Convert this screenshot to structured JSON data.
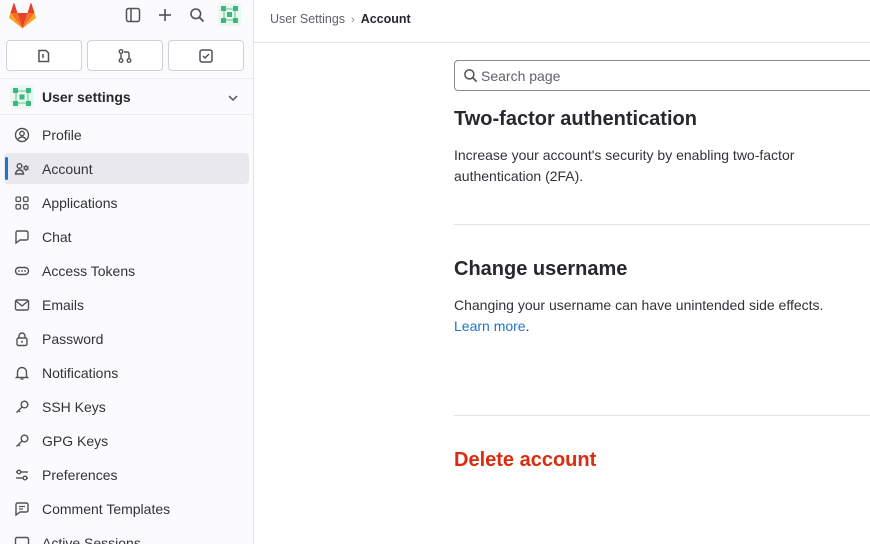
{
  "topbar": {
    "icons": [
      "gitlab-logo",
      "sidebar-toggle-icon",
      "plus-icon",
      "search-icon",
      "user-avatar"
    ]
  },
  "quick_actions": [
    "issues-icon",
    "merge-requests-icon",
    "todo-icon"
  ],
  "context": {
    "title": "User settings"
  },
  "nav": {
    "items": [
      {
        "label": "Profile",
        "icon": "profile-icon",
        "active": false
      },
      {
        "label": "Account",
        "icon": "account-icon",
        "active": true
      },
      {
        "label": "Applications",
        "icon": "applications-icon",
        "active": false
      },
      {
        "label": "Chat",
        "icon": "chat-icon",
        "active": false
      },
      {
        "label": "Access Tokens",
        "icon": "token-icon",
        "active": false
      },
      {
        "label": "Emails",
        "icon": "mail-icon",
        "active": false
      },
      {
        "label": "Password",
        "icon": "lock-icon",
        "active": false
      },
      {
        "label": "Notifications",
        "icon": "bell-icon",
        "active": false
      },
      {
        "label": "SSH Keys",
        "icon": "key-icon",
        "active": false
      },
      {
        "label": "GPG Keys",
        "icon": "key-icon",
        "active": false
      },
      {
        "label": "Preferences",
        "icon": "preferences-icon",
        "active": false
      },
      {
        "label": "Comment Templates",
        "icon": "comment-template-icon",
        "active": false
      },
      {
        "label": "Active Sessions",
        "icon": "sessions-icon",
        "active": false
      }
    ]
  },
  "breadcrumb": {
    "parent": "User Settings",
    "separator": "›",
    "current": "Account"
  },
  "search": {
    "placeholder": "Search page"
  },
  "sections": {
    "two_factor": {
      "title": "Two-factor authentication",
      "description": "Increase your account's security by enabling two-factor authentication (2FA)."
    },
    "change_username": {
      "title": "Change username",
      "description": "Changing your username can have unintended side effects.",
      "link": "Learn more",
      "after_link": "."
    },
    "delete_account": {
      "title": "Delete account"
    }
  },
  "colors": {
    "accent": "#1f75cb",
    "danger": "#dd2b0e",
    "gitlab_orange": "#fc6d26"
  }
}
